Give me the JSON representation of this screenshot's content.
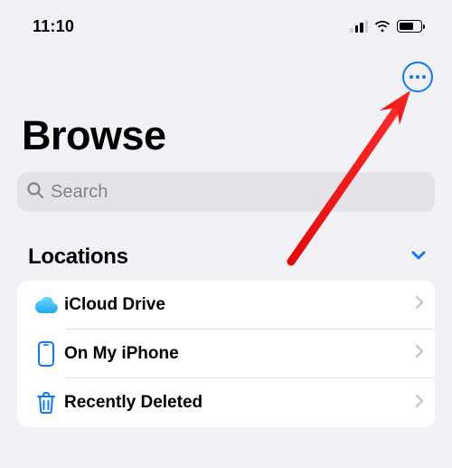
{
  "status": {
    "time": "11:10"
  },
  "header": {
    "title": "Browse"
  },
  "search": {
    "placeholder": "Search"
  },
  "sections": {
    "locations": {
      "title": "Locations",
      "items": [
        {
          "label": "iCloud Drive",
          "icon": "icloud-icon"
        },
        {
          "label": "On My iPhone",
          "icon": "iphone-icon"
        },
        {
          "label": "Recently Deleted",
          "icon": "trash-icon"
        }
      ]
    }
  },
  "colors": {
    "accent": "#0a7aff",
    "bg": "#f2f2f6"
  }
}
